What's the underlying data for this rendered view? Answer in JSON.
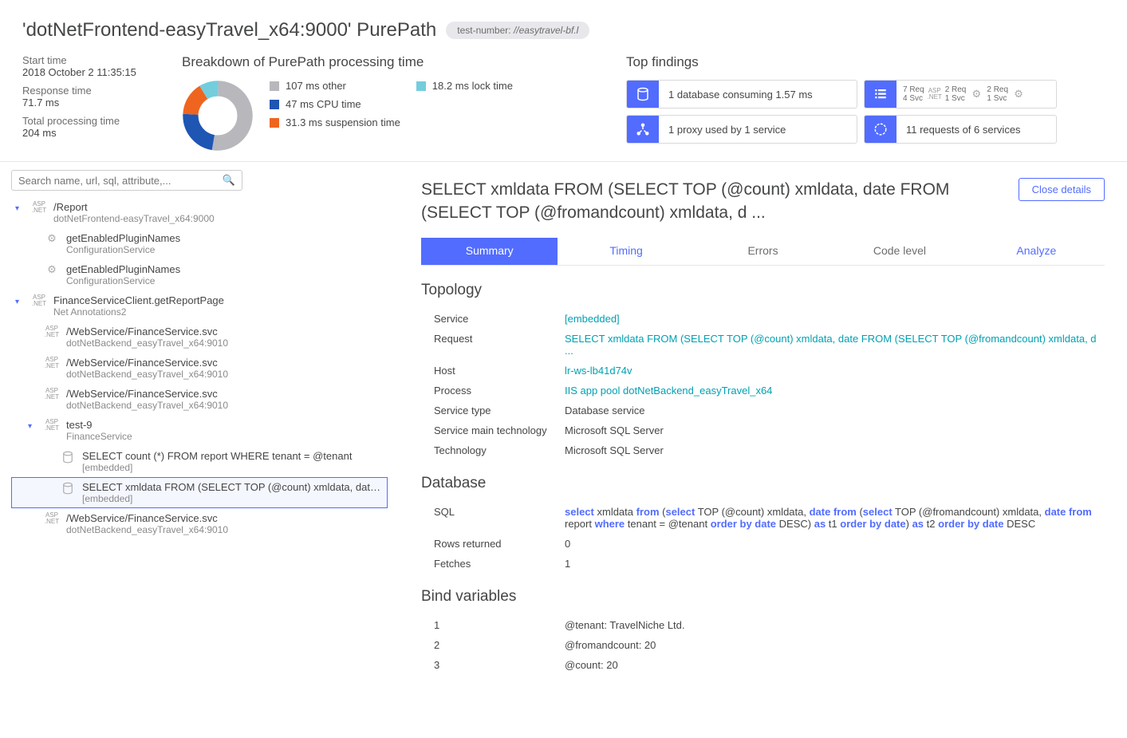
{
  "header": {
    "title": "'dotNetFrontend-easyTravel_x64:9000' PurePath",
    "tag_label": "test-number:",
    "tag_value": "//easytravel-bf.l"
  },
  "meta": {
    "start_label": "Start time",
    "start_value": "2018 October 2 11:35:15",
    "response_label": "Response time",
    "response_value": "71.7 ms",
    "total_label": "Total processing time",
    "total_value": "204 ms"
  },
  "breakdown": {
    "title": "Breakdown of PurePath processing time",
    "items": [
      {
        "color": "#b7b7bc",
        "label": "107 ms other"
      },
      {
        "color": "#1f55b3",
        "label": "47 ms CPU time"
      },
      {
        "color": "#ef651f",
        "label": "31.3 ms suspension time"
      },
      {
        "color": "#74cddd",
        "label": "18.2 ms lock time"
      }
    ]
  },
  "findings": {
    "title": "Top findings",
    "cards": [
      {
        "text": "1 database consuming 1.57 ms"
      },
      {
        "text": "1 proxy used by 1 service"
      },
      {
        "text": "11 requests of 6 services"
      }
    ],
    "chips": [
      {
        "req": "7 Req",
        "svc": "4 Svc"
      },
      {
        "req": "2 Req",
        "svc": "1 Svc"
      },
      {
        "req": "2 Req",
        "svc": "1 Svc"
      }
    ]
  },
  "search": {
    "placeholder": "Search name, url, sql, attribute,..."
  },
  "tree": [
    {
      "indent": 0,
      "expand": true,
      "tech": "asp",
      "title": "/Report",
      "sub": "dotNetFrontend-easyTravel_x64:9000"
    },
    {
      "indent": 1,
      "tech": "svc",
      "title": "getEnabledPluginNames",
      "sub": "ConfigurationService"
    },
    {
      "indent": 1,
      "tech": "svc",
      "title": "getEnabledPluginNames",
      "sub": "ConfigurationService"
    },
    {
      "indent": 0,
      "expand": true,
      "tech": "asp",
      "title": "FinanceServiceClient.getReportPage",
      "sub": "Net Annotations2"
    },
    {
      "indent": 1,
      "tech": "asp",
      "title": "/WebService/FinanceService.svc",
      "sub": "dotNetBackend_easyTravel_x64:9010"
    },
    {
      "indent": 1,
      "tech": "asp",
      "title": "/WebService/FinanceService.svc",
      "sub": "dotNetBackend_easyTravel_x64:9010"
    },
    {
      "indent": 1,
      "tech": "asp",
      "title": "/WebService/FinanceService.svc",
      "sub": "dotNetBackend_easyTravel_x64:9010"
    },
    {
      "indent": 1,
      "expand": true,
      "tech": "asp",
      "title": "test-9",
      "sub": "FinanceService"
    },
    {
      "indent": 2,
      "tech": "db",
      "title": "SELECT count (*) FROM report WHERE tenant = @tenant",
      "sub": "[embedded]"
    },
    {
      "indent": 2,
      "tech": "db",
      "title": "SELECT xmldata FROM (SELECT TOP (@count) xmldata, date FROM (SELE...",
      "sub": "[embedded]",
      "selected": true
    },
    {
      "indent": 1,
      "tech": "asp",
      "title": "/WebService/FinanceService.svc",
      "sub": "dotNetBackend_easyTravel_x64:9010"
    }
  ],
  "detail": {
    "title": "SELECT xmldata FROM (SELECT TOP (@count) xmldata, date FROM (SELECT TOP (@fromandcount) xmldata, d ...",
    "close": "Close details",
    "tabs": [
      "Summary",
      "Timing",
      "Errors",
      "Code level",
      "Analyze"
    ],
    "topology": {
      "title": "Topology",
      "rows": [
        {
          "label": "Service",
          "value": "[embedded]",
          "link": true
        },
        {
          "label": "Request",
          "value": "SELECT xmldata FROM (SELECT TOP (@count) xmldata, date FROM (SELECT TOP (@fromandcount) xmldata, d ...",
          "link": true
        },
        {
          "label": "Host",
          "value": "lr-ws-lb41d74v",
          "link": true
        },
        {
          "label": "Process",
          "value": "IIS app pool dotNetBackend_easyTravel_x64",
          "link": true
        },
        {
          "label": "Service type",
          "value": "Database service"
        },
        {
          "label": "Service main technology",
          "value": "Microsoft SQL Server"
        },
        {
          "label": "Technology",
          "value": "Microsoft SQL Server"
        }
      ]
    },
    "database": {
      "title": "Database",
      "rows": [
        {
          "label": "SQL",
          "sql": true
        },
        {
          "label": "Rows returned",
          "value": "0"
        },
        {
          "label": "Fetches",
          "value": "1"
        }
      ]
    },
    "bindvars": {
      "title": "Bind variables",
      "rows": [
        {
          "label": "1",
          "value": "@tenant: TravelNiche Ltd."
        },
        {
          "label": "2",
          "value": "@fromandcount: 20"
        },
        {
          "label": "3",
          "value": "@count: 20"
        }
      ]
    }
  },
  "chart_data": {
    "type": "pie",
    "title": "Breakdown of PurePath processing time",
    "series": [
      {
        "name": "other",
        "value": 107,
        "color": "#b7b7bc"
      },
      {
        "name": "CPU time",
        "value": 47,
        "color": "#1f55b3"
      },
      {
        "name": "suspension time",
        "value": 31.3,
        "color": "#ef651f"
      },
      {
        "name": "lock time",
        "value": 18.2,
        "color": "#74cddd"
      }
    ]
  }
}
